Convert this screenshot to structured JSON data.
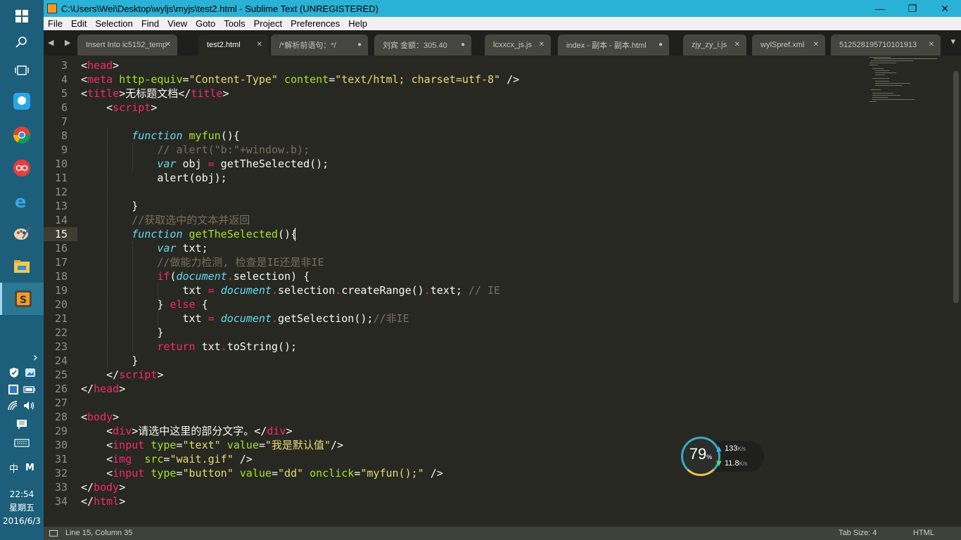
{
  "window": {
    "title": "C:\\Users\\Wei\\Desktop\\wyljs\\myjs\\test2.html - Sublime Text (UNREGISTERED)",
    "minimize": "—",
    "maximize": "❐",
    "close": "✕"
  },
  "menu": [
    "File",
    "Edit",
    "Selection",
    "Find",
    "View",
    "Goto",
    "Tools",
    "Project",
    "Preferences",
    "Help"
  ],
  "tabs": [
    {
      "label": "Insert Into ic5152_temp"
    },
    {
      "label": "test2.html",
      "active": true
    },
    {
      "label": "/*解析前语句：*/"
    },
    {
      "label": "刘宾 金额：305.40"
    },
    {
      "label": "lcxxcx_js.js"
    },
    {
      "label": "index - 副本 - 副本.html"
    },
    {
      "label": "zjy_zy_i.js"
    },
    {
      "label": "wylSpref.xml"
    },
    {
      "label": "512528195710101913"
    }
  ],
  "tab_nav": {
    "arrows": "◀ ▶",
    "more": "▾"
  },
  "editor": {
    "current_line": 15,
    "lines": [
      {
        "n": "3",
        "tokens": [
          [
            "t-plain",
            "<"
          ],
          [
            "t-tag",
            "head"
          ],
          [
            "t-plain",
            ">"
          ]
        ]
      },
      {
        "n": "4",
        "tokens": [
          [
            "t-plain",
            "<"
          ],
          [
            "t-tag",
            "meta"
          ],
          [
            "t-plain",
            " "
          ],
          [
            "t-attr",
            "http-equiv"
          ],
          [
            "t-plain",
            "="
          ],
          [
            "t-str",
            "\"Content-Type\""
          ],
          [
            "t-plain",
            " "
          ],
          [
            "t-attr",
            "content"
          ],
          [
            "t-plain",
            "="
          ],
          [
            "t-str",
            "\"text/html; charset=utf-8\""
          ],
          [
            "t-plain",
            " />"
          ]
        ]
      },
      {
        "n": "5",
        "tokens": [
          [
            "t-plain",
            "<"
          ],
          [
            "t-tag",
            "title"
          ],
          [
            "t-plain",
            ">无标题文档</"
          ],
          [
            "t-tag",
            "title"
          ],
          [
            "t-plain",
            ">"
          ]
        ]
      },
      {
        "n": "6",
        "tokens": [
          [
            "t-plain",
            "    <"
          ],
          [
            "t-tag",
            "script"
          ],
          [
            "t-plain",
            ">"
          ]
        ]
      },
      {
        "n": "7",
        "tokens": []
      },
      {
        "n": "8",
        "tokens": [
          [
            "t-plain",
            "        "
          ],
          [
            "t-kw",
            "function"
          ],
          [
            "t-plain",
            " "
          ],
          [
            "t-fn",
            "myfun"
          ],
          [
            "t-plain",
            "(){"
          ]
        ]
      },
      {
        "n": "9",
        "tokens": [
          [
            "t-plain",
            "            "
          ],
          [
            "t-cm",
            "// alert(\"b:\"+window.b);"
          ]
        ]
      },
      {
        "n": "10",
        "tokens": [
          [
            "t-plain",
            "            "
          ],
          [
            "t-kw",
            "var"
          ],
          [
            "t-plain",
            " obj "
          ],
          [
            "t-op",
            "="
          ],
          [
            "t-plain",
            " getTheSelected();"
          ]
        ]
      },
      {
        "n": "11",
        "tokens": [
          [
            "t-plain",
            "            alert(obj);"
          ]
        ]
      },
      {
        "n": "12",
        "tokens": []
      },
      {
        "n": "13",
        "tokens": [
          [
            "t-plain",
            "        }"
          ]
        ]
      },
      {
        "n": "14",
        "tokens": [
          [
            "t-plain",
            "        "
          ],
          [
            "t-cm",
            "//获取选中的文本并返回"
          ]
        ]
      },
      {
        "n": "15",
        "tokens": [
          [
            "t-plain",
            "        "
          ],
          [
            "t-kw",
            "function"
          ],
          [
            "t-plain",
            " "
          ],
          [
            "t-fn",
            "getTheSelected"
          ],
          [
            "t-plain",
            "(){"
          ]
        ]
      },
      {
        "n": "16",
        "tokens": [
          [
            "t-plain",
            "            "
          ],
          [
            "t-kw",
            "var"
          ],
          [
            "t-plain",
            " txt;"
          ]
        ]
      },
      {
        "n": "17",
        "tokens": [
          [
            "t-plain",
            "            "
          ],
          [
            "t-cm",
            "//做能力检测, 检查是IE还是非IE"
          ]
        ]
      },
      {
        "n": "18",
        "tokens": [
          [
            "t-plain",
            "            "
          ],
          [
            "t-ctl",
            "if"
          ],
          [
            "t-plain",
            "("
          ],
          [
            "t-obj",
            "document"
          ],
          [
            "t-op",
            "."
          ],
          [
            "t-plain",
            "selection) {"
          ]
        ]
      },
      {
        "n": "19",
        "tokens": [
          [
            "t-plain",
            "                txt "
          ],
          [
            "t-op",
            "="
          ],
          [
            "t-plain",
            " "
          ],
          [
            "t-obj",
            "document"
          ],
          [
            "t-op",
            "."
          ],
          [
            "t-plain",
            "selection"
          ],
          [
            "t-op",
            "."
          ],
          [
            "t-plain",
            "createRange()"
          ],
          [
            "t-op",
            "."
          ],
          [
            "t-plain",
            "text; "
          ],
          [
            "t-cm",
            "// IE"
          ]
        ]
      },
      {
        "n": "20",
        "tokens": [
          [
            "t-plain",
            "            } "
          ],
          [
            "t-ctl",
            "else"
          ],
          [
            "t-plain",
            " {"
          ]
        ]
      },
      {
        "n": "21",
        "tokens": [
          [
            "t-plain",
            "                txt "
          ],
          [
            "t-op",
            "="
          ],
          [
            "t-plain",
            " "
          ],
          [
            "t-obj",
            "document"
          ],
          [
            "t-op",
            "."
          ],
          [
            "t-plain",
            "getSelection();"
          ],
          [
            "t-cm",
            "//非IE"
          ]
        ]
      },
      {
        "n": "22",
        "tokens": [
          [
            "t-plain",
            "            }"
          ]
        ]
      },
      {
        "n": "23",
        "tokens": [
          [
            "t-plain",
            "            "
          ],
          [
            "t-ctl",
            "return"
          ],
          [
            "t-plain",
            " txt"
          ],
          [
            "t-op",
            "."
          ],
          [
            "t-plain",
            "toString();"
          ]
        ]
      },
      {
        "n": "24",
        "tokens": [
          [
            "t-plain",
            "        }"
          ]
        ]
      },
      {
        "n": "25",
        "tokens": [
          [
            "t-plain",
            "    </"
          ],
          [
            "t-tag",
            "script"
          ],
          [
            "t-plain",
            ">"
          ]
        ]
      },
      {
        "n": "26",
        "tokens": [
          [
            "t-plain",
            "</"
          ],
          [
            "t-tag",
            "head"
          ],
          [
            "t-plain",
            ">"
          ]
        ]
      },
      {
        "n": "27",
        "tokens": []
      },
      {
        "n": "28",
        "tokens": [
          [
            "t-plain",
            "<"
          ],
          [
            "t-tag",
            "body"
          ],
          [
            "t-plain",
            ">"
          ]
        ]
      },
      {
        "n": "29",
        "tokens": [
          [
            "t-plain",
            "    <"
          ],
          [
            "t-tag",
            "div"
          ],
          [
            "t-plain",
            ">请选中这里的部分文字。</"
          ],
          [
            "t-tag",
            "div"
          ],
          [
            "t-plain",
            ">"
          ]
        ]
      },
      {
        "n": "30",
        "tokens": [
          [
            "t-plain",
            "    <"
          ],
          [
            "t-tag",
            "input"
          ],
          [
            "t-plain",
            " "
          ],
          [
            "t-attr",
            "type"
          ],
          [
            "t-plain",
            "="
          ],
          [
            "t-str",
            "\"text\""
          ],
          [
            "t-plain",
            " "
          ],
          [
            "t-attr",
            "value"
          ],
          [
            "t-plain",
            "="
          ],
          [
            "t-str",
            "\"我是默认值\""
          ],
          [
            "t-plain",
            "/>"
          ]
        ]
      },
      {
        "n": "31",
        "tokens": [
          [
            "t-plain",
            "    <"
          ],
          [
            "t-tag",
            "img"
          ],
          [
            "t-plain",
            "  "
          ],
          [
            "t-attr",
            "src"
          ],
          [
            "t-plain",
            "="
          ],
          [
            "t-str",
            "\"wait.gif\""
          ],
          [
            "t-plain",
            " />"
          ]
        ]
      },
      {
        "n": "32",
        "tokens": [
          [
            "t-plain",
            "    <"
          ],
          [
            "t-tag",
            "input"
          ],
          [
            "t-plain",
            " "
          ],
          [
            "t-attr",
            "type"
          ],
          [
            "t-plain",
            "="
          ],
          [
            "t-str",
            "\"button\""
          ],
          [
            "t-plain",
            " "
          ],
          [
            "t-attr",
            "value"
          ],
          [
            "t-plain",
            "="
          ],
          [
            "t-str",
            "\"dd\""
          ],
          [
            "t-plain",
            " "
          ],
          [
            "t-attr",
            "onclick"
          ],
          [
            "t-plain",
            "="
          ],
          [
            "t-str",
            "\"myfun();\""
          ],
          [
            "t-plain",
            " />"
          ]
        ]
      },
      {
        "n": "33",
        "tokens": [
          [
            "t-plain",
            "</"
          ],
          [
            "t-tag",
            "body"
          ],
          [
            "t-plain",
            ">"
          ]
        ]
      },
      {
        "n": "34",
        "tokens": [
          [
            "t-plain",
            "</"
          ],
          [
            "t-tag",
            "html"
          ],
          [
            "t-plain",
            ">"
          ]
        ]
      }
    ]
  },
  "status": {
    "position": "Line 15, Column 35",
    "tab_size": "Tab Size: 4",
    "syntax": "HTML"
  },
  "net_widget": {
    "percent": "79",
    "percent_unit": "%",
    "up": "133",
    "up_unit": "K/s",
    "down": "11.8",
    "down_unit": "K/s"
  },
  "taskbar": {
    "clock_time": "22:54",
    "clock_day": "星期五",
    "clock_date": "2016/6/3",
    "ime_lang": "中",
    "ime_mode": "M",
    "tray_expand": "›"
  },
  "colors": {
    "titlebar": "#2ab2d6",
    "editor_bg": "#272822",
    "taskbar": "#1d5f7a"
  }
}
